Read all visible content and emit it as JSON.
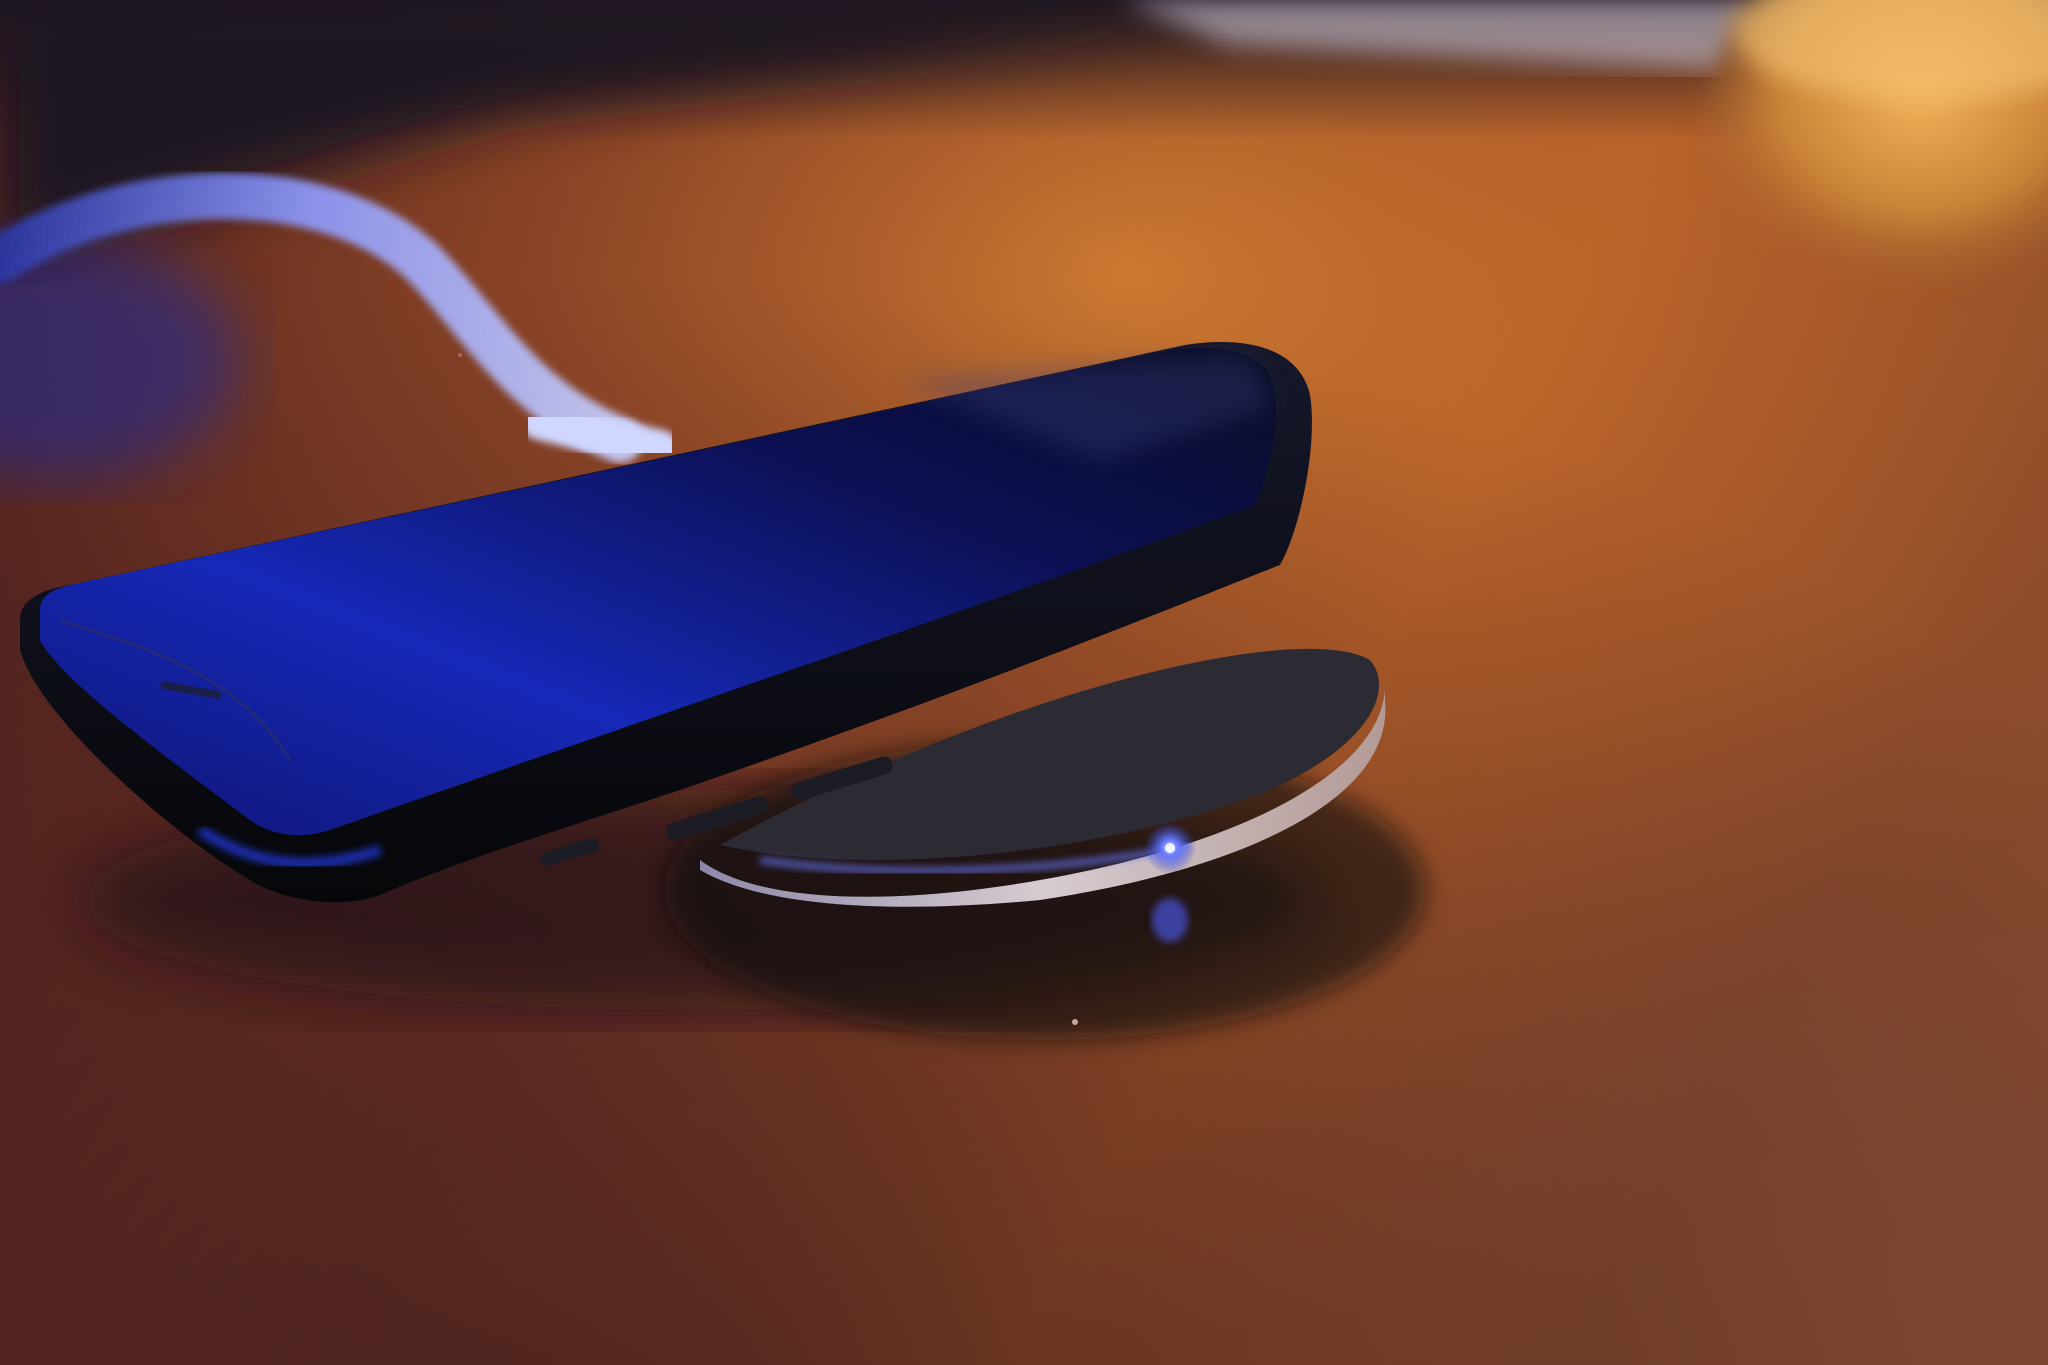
{
  "scene": {
    "subject": "smartphone-on-wireless-charger",
    "colors": {
      "desk_dark": "#3a1a16",
      "desk_mid": "#6e3424",
      "desk_warm": "#b5602a",
      "desk_glow": "#d9822f",
      "phone_body": "#0c0d16",
      "phone_screen": "#0d0f3a",
      "screen_blue": "#1726a8",
      "cable": "#9aa8ff",
      "pad_rim": "#b8aeb8",
      "pad_top": "#2a2a30",
      "led": "#6a7bff",
      "lamp": "#e9a04a"
    }
  }
}
